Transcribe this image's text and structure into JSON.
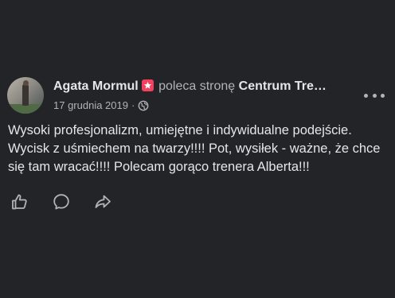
{
  "post": {
    "author": "Agata Mormul",
    "action_text": "poleca stronę",
    "page_name": "Centrum Tre…",
    "date": "17 grudnia 2019",
    "separator": "·",
    "text": "Wysoki profesjonalizm, umiejętne i indywidualne podejście. Wycisk z uśmiechem na twarzy!!!! Pot,  wysiłek - ważne, że chce się tam wracać!!!! Polecam gorąco trenera Alberta!!!",
    "privacy_icon": "globe-icon",
    "badge_icon": "recommend-star-icon",
    "badge_color": "#f3425f"
  },
  "actions": [
    {
      "icon": "thumbs-up-icon"
    },
    {
      "icon": "comment-icon"
    },
    {
      "icon": "share-icon"
    }
  ],
  "colors": {
    "background": "#232427",
    "primary_text": "#e4e6eb",
    "secondary_text": "#b0b3b8"
  }
}
